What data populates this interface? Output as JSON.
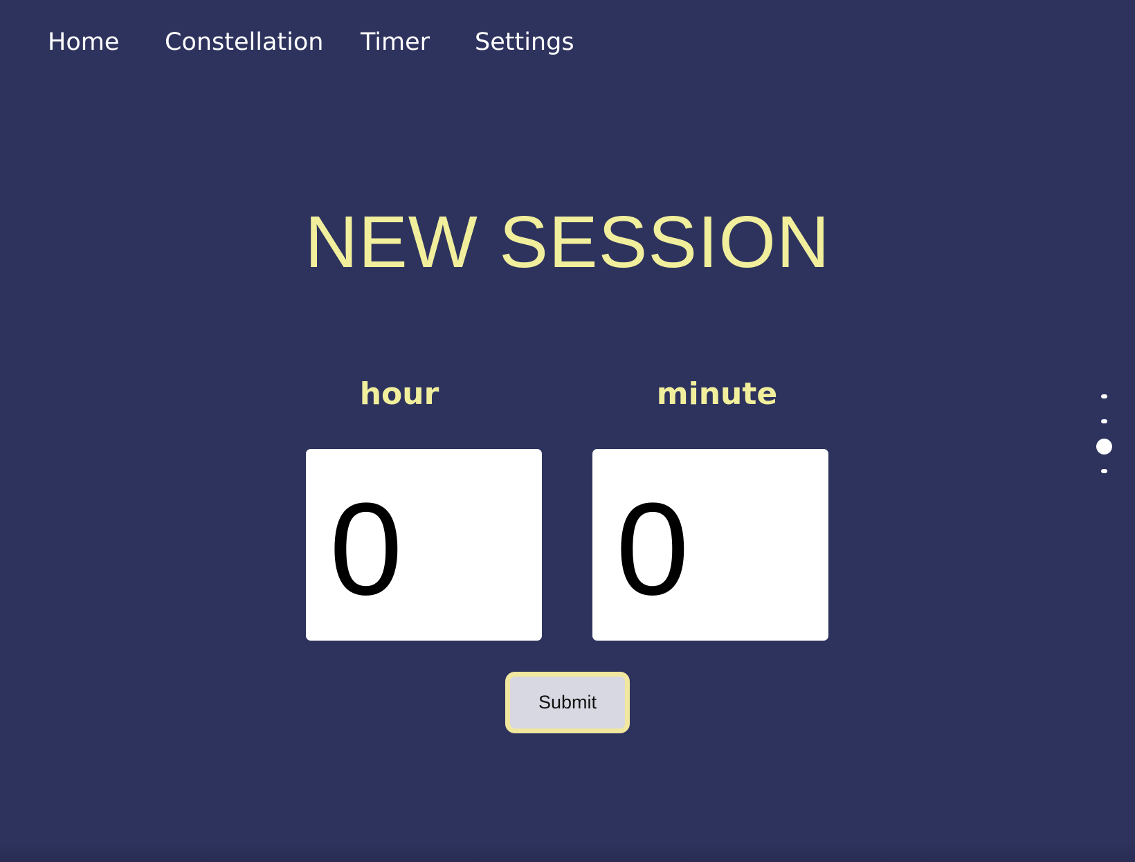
{
  "nav": {
    "items": [
      {
        "label": "Home"
      },
      {
        "label": "Constellation"
      },
      {
        "label": "Timer"
      },
      {
        "label": "Settings"
      }
    ]
  },
  "main": {
    "title": "NEW SESSION",
    "hour": {
      "label": "hour",
      "value": "0"
    },
    "minute": {
      "label": "minute",
      "value": "0"
    },
    "submit_label": "Submit"
  },
  "pager": {
    "dot_count": 4,
    "active_index": 2
  },
  "colors": {
    "background": "#2e335e",
    "accent_yellow": "#f1ef9c",
    "button_border": "#f1e79e",
    "button_fill": "#d8d8e2"
  }
}
